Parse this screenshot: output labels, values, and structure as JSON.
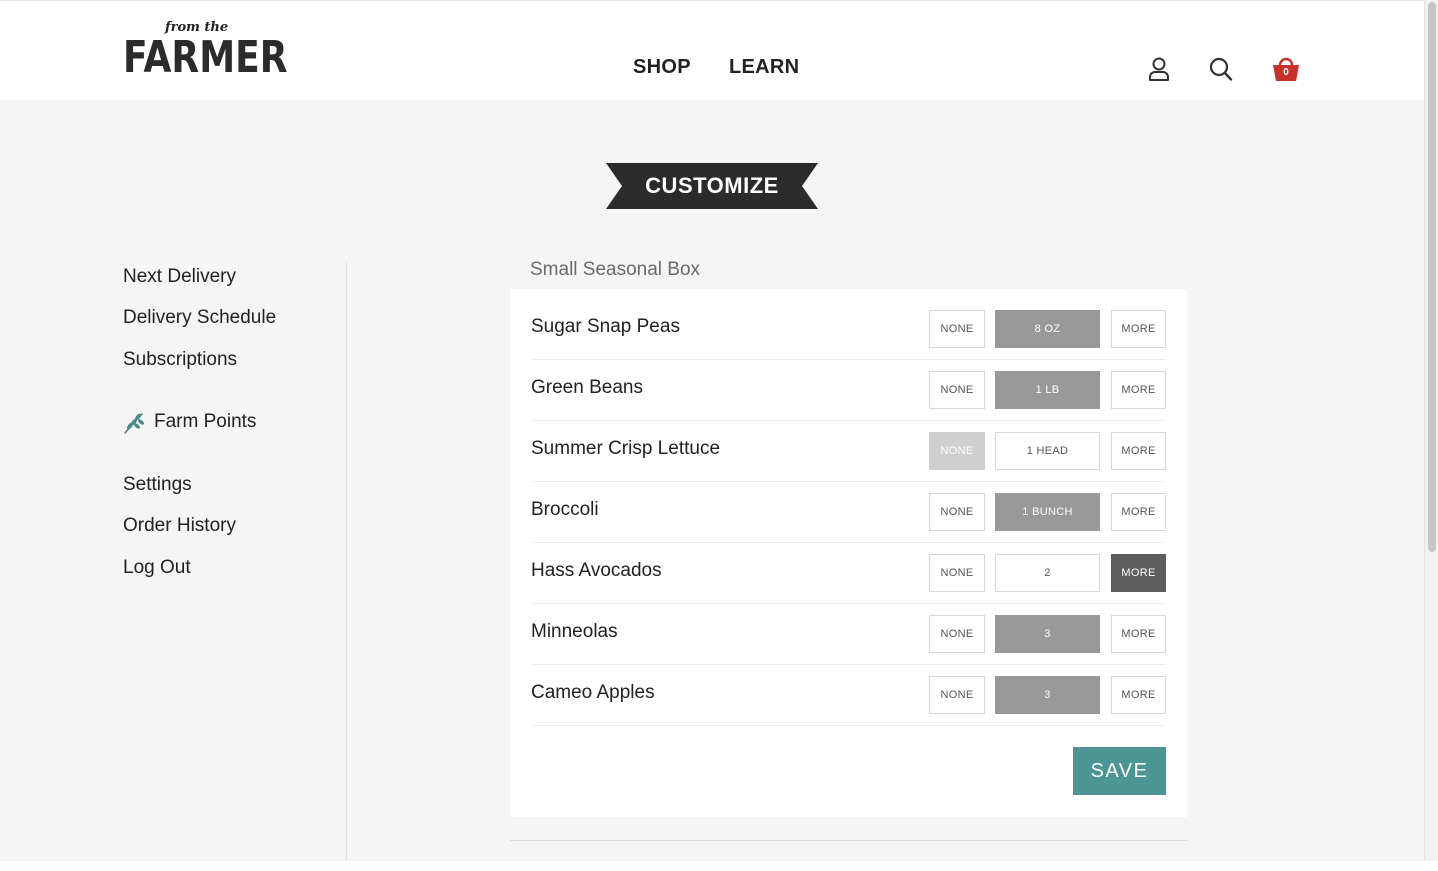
{
  "brand": {
    "logo_small": "from the",
    "logo_big": "FARMER"
  },
  "nav": {
    "shop": "SHOP",
    "learn": "LEARN"
  },
  "header_icons": {
    "account": "user-icon",
    "search": "search-icon",
    "cart": "basket-icon",
    "cart_count": "0",
    "cart_color": "#c9302c"
  },
  "banner": {
    "text": "CUSTOMIZE",
    "color": "#2b2b2b"
  },
  "sidebar": {
    "items": [
      {
        "label": "Next Delivery"
      },
      {
        "label": "Delivery Schedule"
      },
      {
        "label": "Subscriptions"
      },
      {
        "label": "Farm Points",
        "icon": "leaf-icon"
      },
      {
        "label": "Settings"
      },
      {
        "label": "Order History"
      },
      {
        "label": "Log Out"
      }
    ]
  },
  "box": {
    "title": "Small Seasonal Box",
    "items": [
      {
        "name": "Sugar Snap Peas",
        "none": "NONE",
        "qty": "8 OZ",
        "more": "MORE",
        "selected": "qty"
      },
      {
        "name": "Green Beans",
        "none": "NONE",
        "qty": "1 LB",
        "more": "MORE",
        "selected": "qty"
      },
      {
        "name": "Summer Crisp Lettuce",
        "none": "NONE",
        "qty": "1 HEAD",
        "more": "MORE",
        "selected": "none"
      },
      {
        "name": "Broccoli",
        "none": "NONE",
        "qty": "1 BUNCH",
        "more": "MORE",
        "selected": "qty"
      },
      {
        "name": "Hass Avocados",
        "none": "NONE",
        "qty": "2",
        "more": "MORE",
        "selected": "more"
      },
      {
        "name": "Minneolas",
        "none": "NONE",
        "qty": "3",
        "more": "MORE",
        "selected": "qty"
      },
      {
        "name": "Cameo Apples",
        "none": "NONE",
        "qty": "3",
        "more": "MORE",
        "selected": "qty"
      }
    ],
    "save_label": "SAVE",
    "save_color": "#4b9595"
  }
}
